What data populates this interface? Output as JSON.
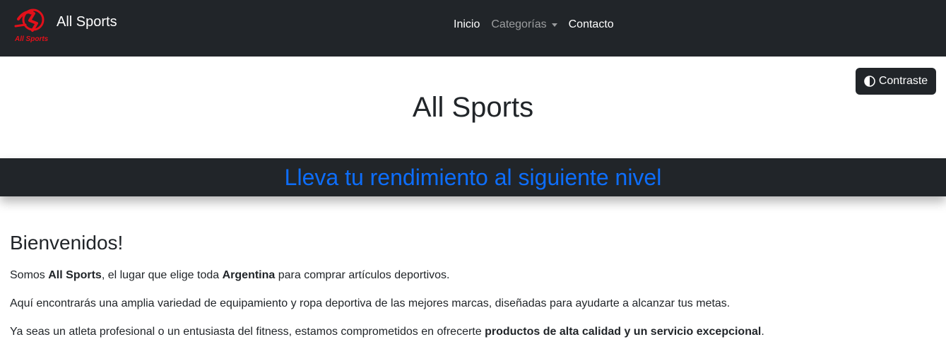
{
  "nav": {
    "brand": "All Sports",
    "logo_text": "All Sports",
    "links": {
      "inicio": "Inicio",
      "categorias": "Categorías",
      "contacto": "Contacto"
    }
  },
  "contrast_button": {
    "label": "Contraste",
    "icon": "half-circle-icon"
  },
  "page_title": "All Sports",
  "banner": "Lleva tu rendimiento al siguiente nivel",
  "welcome": {
    "title": "Bienvenidos!",
    "p1": {
      "t1": "Somos ",
      "b1": "All Sports",
      "t2": ", el lugar que elige toda ",
      "b2": "Argentina",
      "t3": " para comprar artículos deportivos."
    },
    "p2": "Aquí encontrarás una amplia variedad de equipamiento y ropa deportiva de las mejores marcas, diseñadas para ayudarte a alcanzar tus metas.",
    "p3": {
      "t1": "Ya seas un atleta profesional o un entusiasta del fitness, estamos comprometidos en ofrecerte ",
      "b1": "productos de alta calidad y un servicio excepcional",
      "t2": "."
    }
  },
  "colors": {
    "nav_bg": "#212529",
    "accent": "#0d6efd",
    "logo_red": "#e3101a"
  }
}
